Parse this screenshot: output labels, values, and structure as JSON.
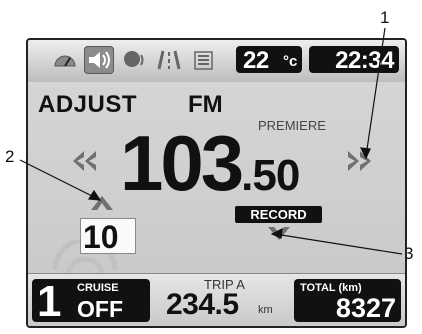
{
  "top_bar": {
    "icons": [
      "gauge-icon",
      "speaker-icon",
      "voice-icon",
      "road-icon",
      "list-icon"
    ],
    "temperature": {
      "value": "22",
      "unit": "°c"
    },
    "clock": "22:34"
  },
  "radio": {
    "mode": "ADJUST",
    "band": "FM",
    "station_name": "PREMIERE",
    "frequency_main": "103",
    "frequency_decimal": ".50",
    "preset": "10",
    "record_label": "RECORD"
  },
  "bottom_bar": {
    "gear": "1",
    "cruise_label": "CRUISE",
    "cruise_state": "OFF",
    "trip_label": "TRIP A",
    "trip_value": "234.5",
    "trip_unit": "km",
    "total_label": "TOTAL (km)",
    "total_value": "8327"
  },
  "callouts": [
    "1",
    "2",
    "3"
  ],
  "colors": {
    "display_bg": "#cfcfcf",
    "box_bg": "#111111",
    "box_text": "#ffffff",
    "active_tab": "#8c8c8c"
  }
}
